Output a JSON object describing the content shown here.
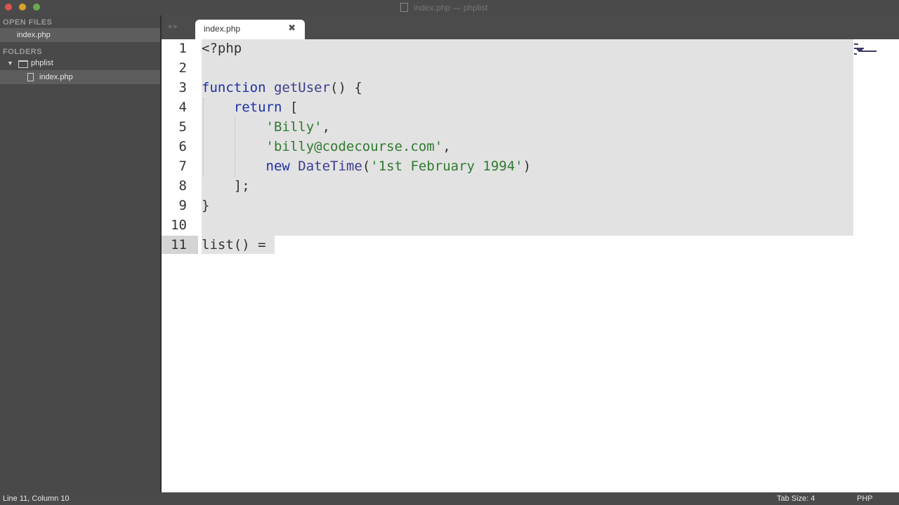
{
  "window": {
    "title": "index.php — phplist"
  },
  "sidebar": {
    "open_files_header": "OPEN FILES",
    "open_file": "index.php",
    "folders_header": "FOLDERS",
    "folder": "phplist",
    "folder_file": "index.php"
  },
  "tabs": [
    {
      "label": "index.php",
      "close": "✖"
    }
  ],
  "editor": {
    "line_numbers": [
      "1",
      "2",
      "3",
      "4",
      "5",
      "6",
      "7",
      "8",
      "9",
      "10",
      "11"
    ],
    "line1": "<?php",
    "line3_kw": "function",
    "line3_fn": "getUser",
    "line3_rest": "() {",
    "line4_kw": "return",
    "line4_rest": " [",
    "line5_str": "'Billy'",
    "line5_rest": ",",
    "line6_str": "'billy@codecourse.com'",
    "line6_rest": ",",
    "line7_kw": "new",
    "line7_cls": "DateTime",
    "line7_open": "(",
    "line7_str": "'1st February 1994'",
    "line7_close": ")",
    "line8": "];",
    "line9": "}",
    "line11": "list() ="
  },
  "status": {
    "position": "Line 11, Column 10",
    "tab_size": "Tab Size: 4",
    "syntax": "PHP"
  },
  "colors": {
    "keyword": "#1b2fa8",
    "string": "#2f7a2f",
    "selection": "#e2e2e2"
  }
}
